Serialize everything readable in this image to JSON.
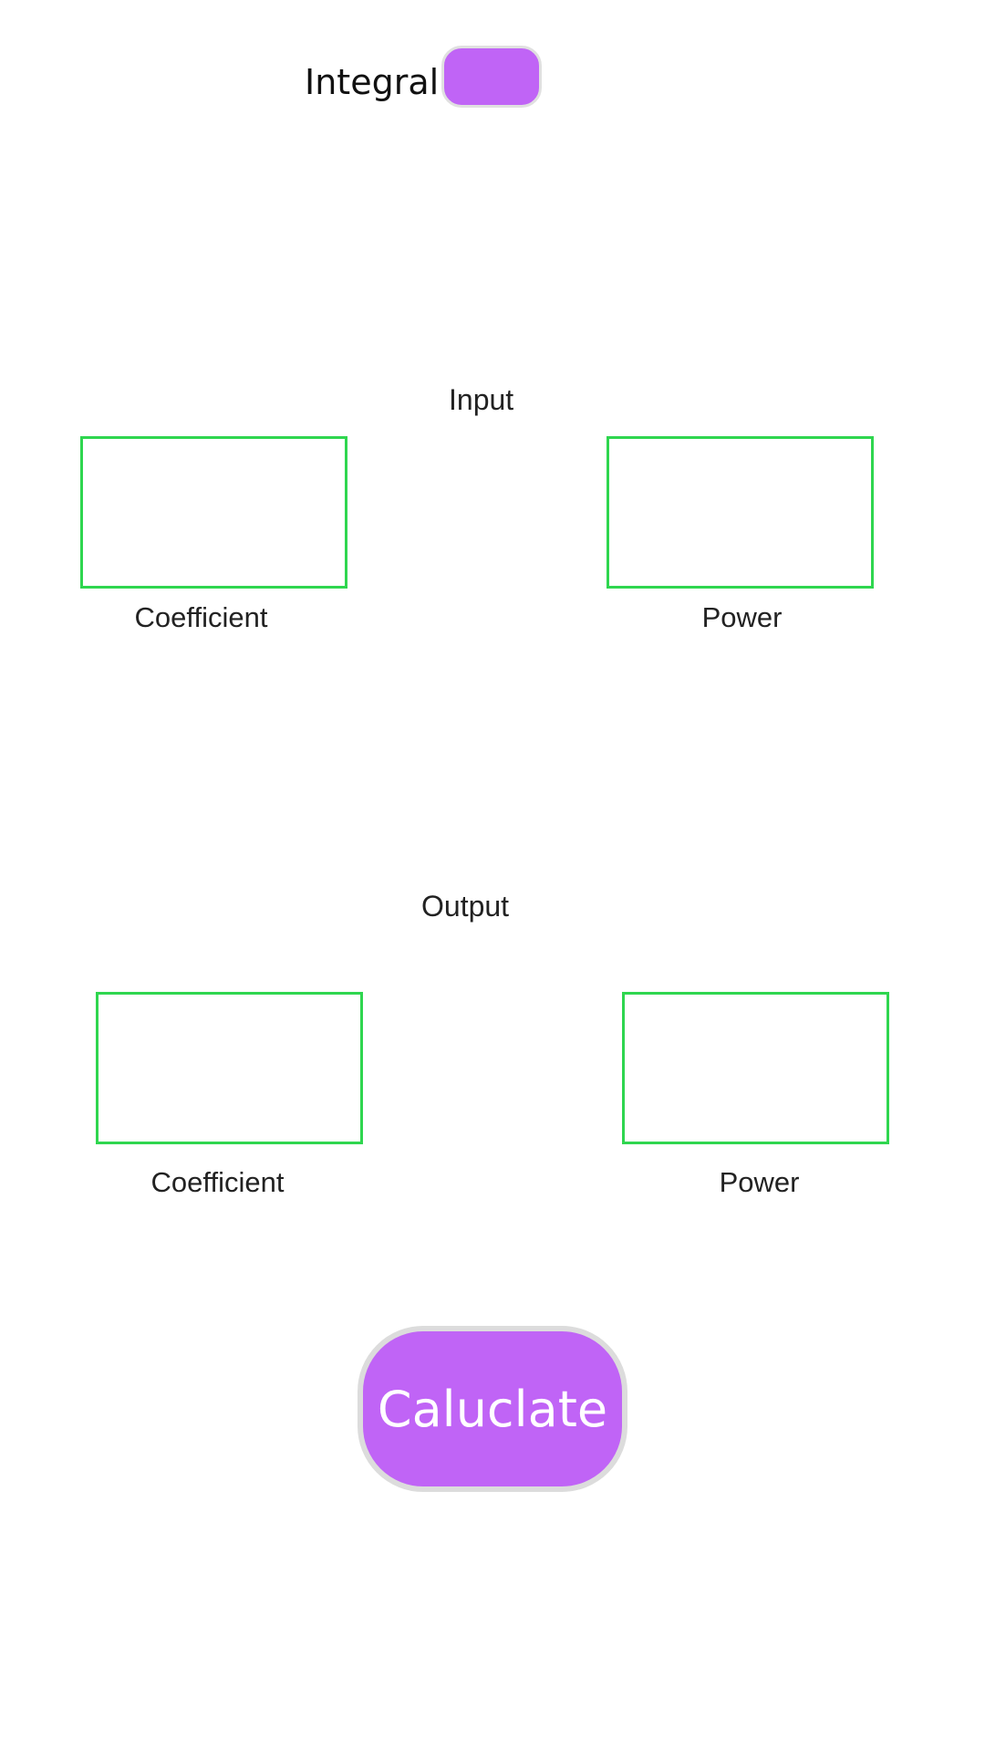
{
  "header": {
    "integral_label": "Integral",
    "toggle_color": "#c064f6"
  },
  "input": {
    "section_label": "Input",
    "coefficient_label": "Coefficient",
    "coefficient_value": "",
    "power_label": "Power",
    "power_value": ""
  },
  "output": {
    "section_label": "Output",
    "coefficient_label": "Coefficient",
    "coefficient_value": "",
    "power_label": "Power",
    "power_value": ""
  },
  "actions": {
    "calculate_label": "Caluclate",
    "button_color": "#c064f6",
    "field_border_color": "#2fd64f"
  }
}
